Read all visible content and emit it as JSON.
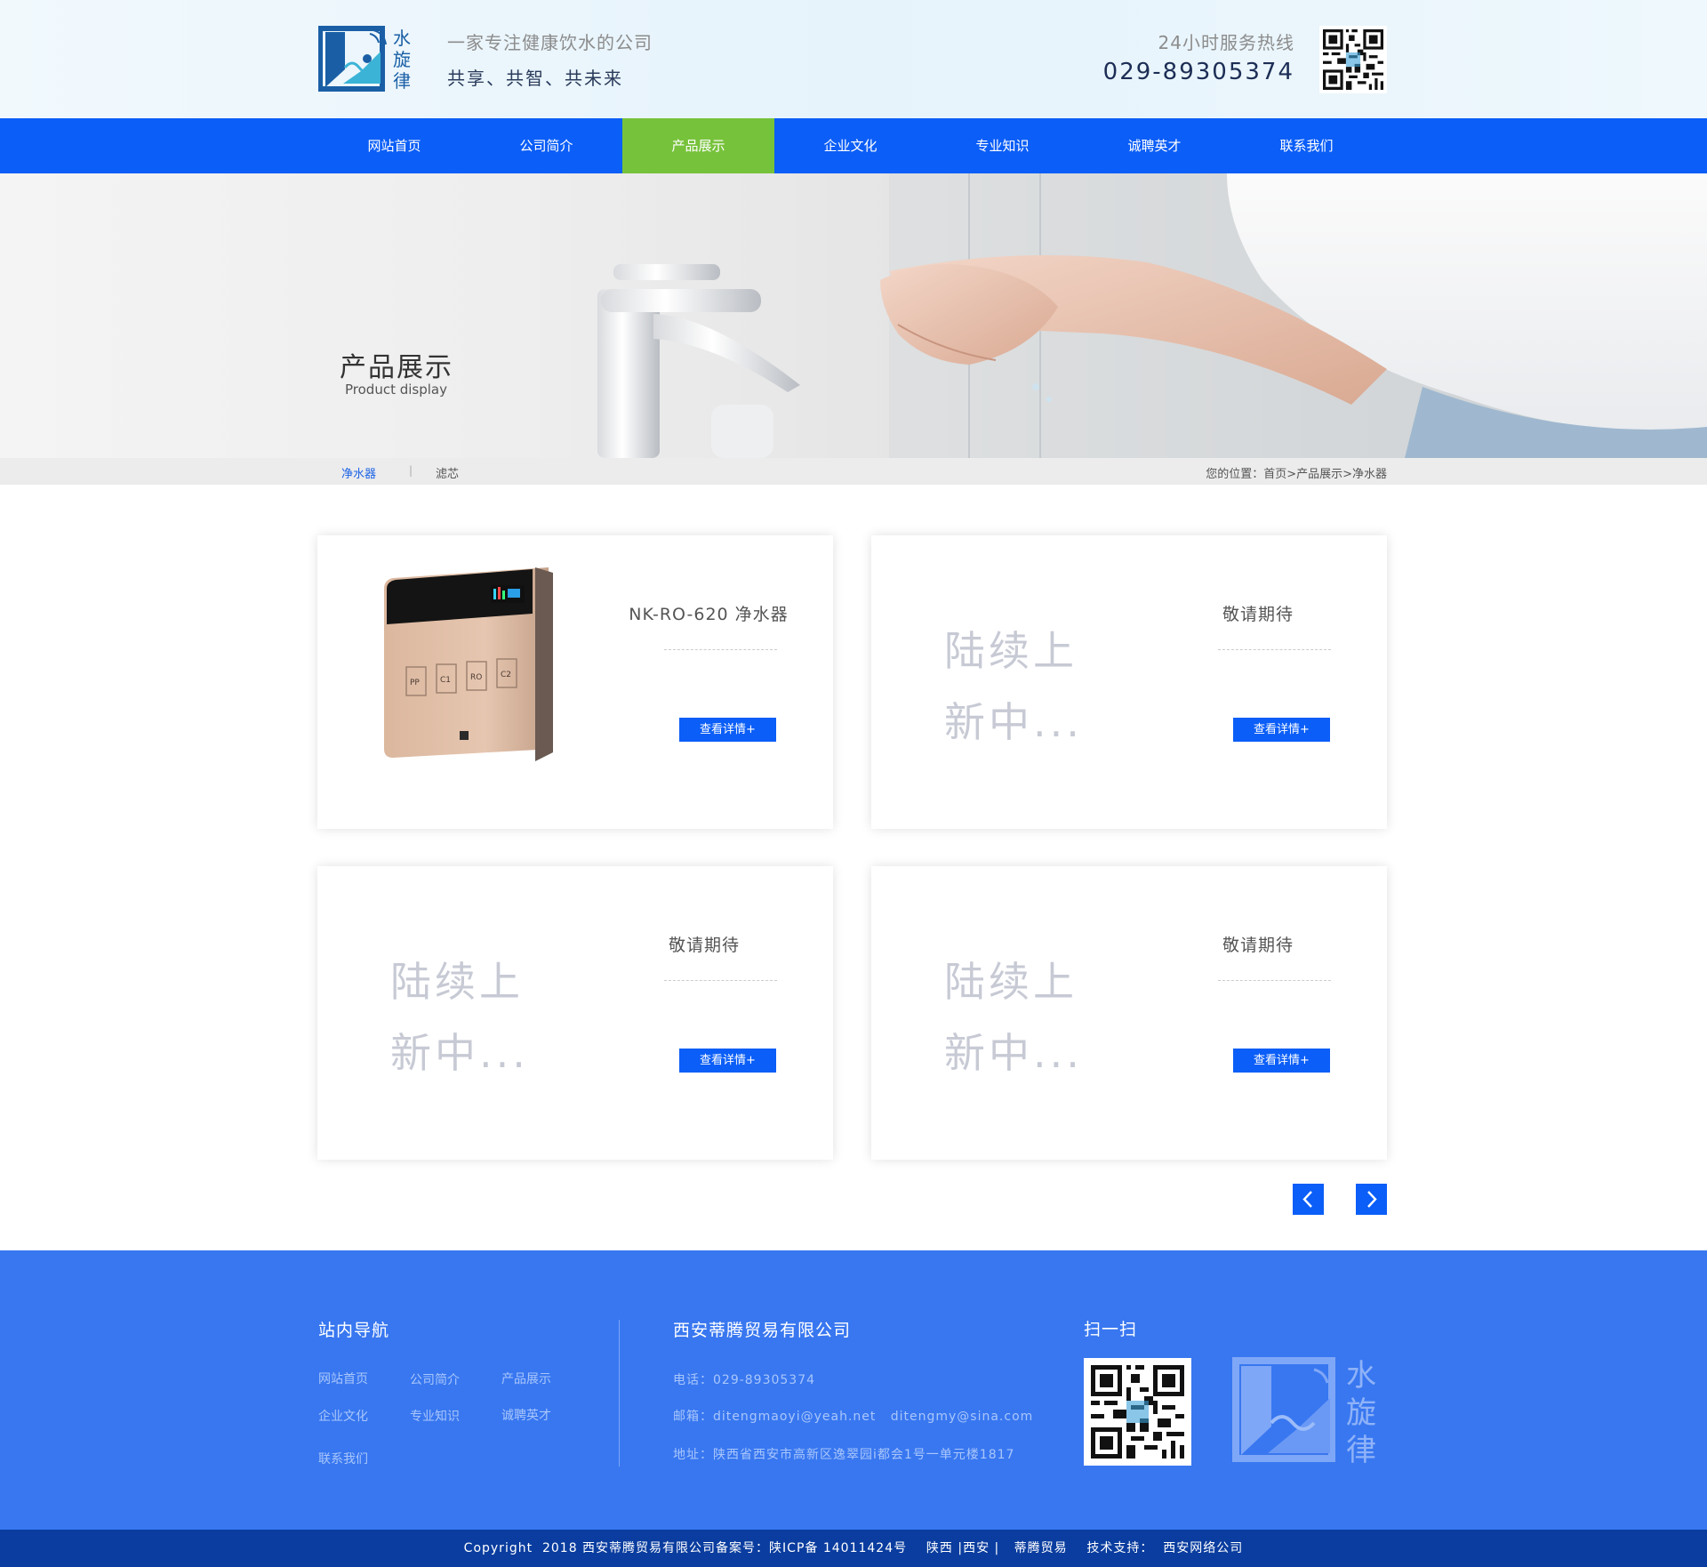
{
  "header": {
    "logo_text": "水旋律",
    "slogan_line1": "一家专注健康饮水的公司",
    "slogan_line2": "共享、共智、共未来",
    "hotline_label": "24小时服务热线",
    "hotline_number": "029-89305374"
  },
  "nav": {
    "items": [
      {
        "label": "网站首页"
      },
      {
        "label": "公司简介"
      },
      {
        "label": "产品展示"
      },
      {
        "label": "企业文化"
      },
      {
        "label": "专业知识"
      },
      {
        "label": "诚聘英才"
      },
      {
        "label": "联系我们"
      }
    ],
    "active_index": 2,
    "active_color": "#77c23b",
    "bar_color": "#0b5ef7"
  },
  "banner": {
    "title": "产品展示",
    "subtitle": "Product display"
  },
  "subnav": {
    "items": [
      "净水器",
      "滤芯"
    ],
    "separator": "|",
    "breadcrumb": "您的位置：首页>产品展示>净水器"
  },
  "products": [
    {
      "title": "NK-RO-620 净水器",
      "placeholder": "",
      "button": "查看详情+",
      "device_labels": [
        "PP",
        "C1",
        "RO",
        "C2"
      ]
    },
    {
      "title": "敬请期待",
      "placeholder_line1": "陆续上",
      "placeholder_line2": "新中...",
      "button": "查看详情+"
    },
    {
      "title": "敬请期待",
      "placeholder_line1": "陆续上",
      "placeholder_line2": "新中...",
      "button": "查看详情+"
    },
    {
      "title": "敬请期待",
      "placeholder_line1": "陆续上",
      "placeholder_line2": "新中...",
      "button": "查看详情+"
    }
  ],
  "pager": {
    "prev_icon": "chevron-left-icon",
    "next_icon": "chevron-right-icon"
  },
  "footer": {
    "nav_heading": "站内导航",
    "nav_links": [
      "网站首页",
      "公司简介",
      "产品展示",
      "企业文化",
      "专业知识",
      "诚聘英才",
      "联系我们"
    ],
    "company_name": "西安蒂腾贸易有限公司",
    "phone": "电话：029-89305374",
    "email": "邮箱：ditengmaoyi@yeah.net   ditengmy@sina.com",
    "address": "地址：陕西省西安市高新区逸翠园i都会1号一单元楼1817",
    "scan_heading": "扫一扫",
    "logo_text": "水旋律",
    "copyright": "Copyright  2018 西安蒂腾贸易有限公司备案号：陕ICP备 14011424号    陕西 |西安 |   蒂腾贸易    技术支持：  西安网络公司"
  }
}
